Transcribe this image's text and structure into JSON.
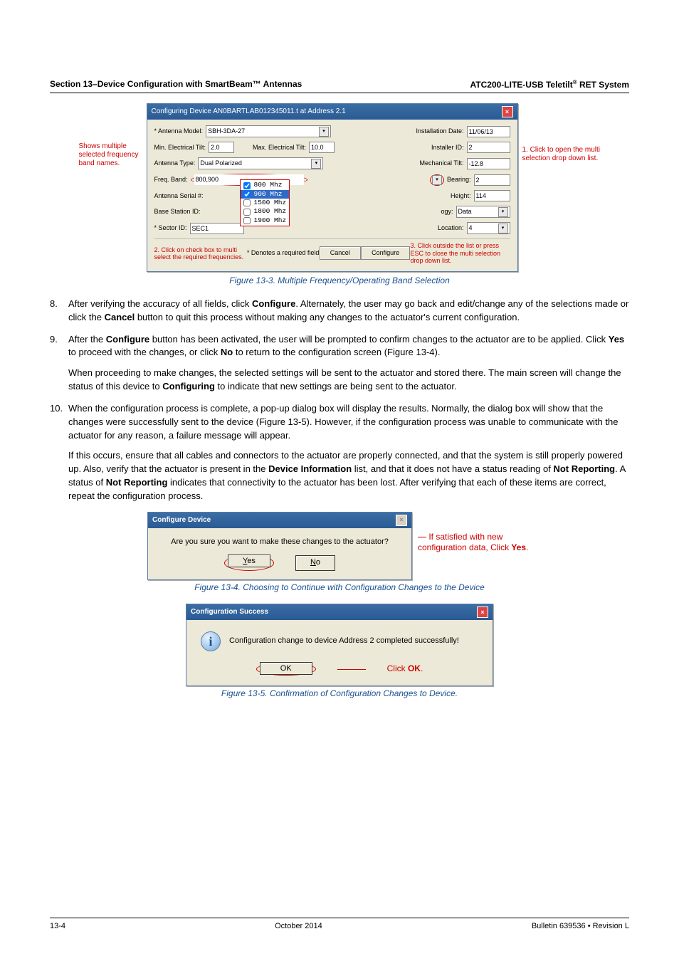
{
  "header": {
    "left": "Section 13–Device Configuration with SmartBeam™ Antennas",
    "right_html": "ATC200-LITE-USB Teletilt<sup>®</sup> RET System"
  },
  "fig1": {
    "titlebar": "Configuring Device AN0BARTLAB012345011.t at Address 2.1",
    "fields": {
      "model_lbl": "* Antenna Model:",
      "model_val": "SBH-3DA-27",
      "inst_date_lbl": "Installation Date:",
      "inst_date_val": "11/06/13",
      "min_tilt_lbl": "Min. Electrical Tilt:",
      "min_tilt_val": "2.0",
      "max_tilt_lbl": "Max. Electrical Tilt:",
      "max_tilt_val": "10.0",
      "installer_lbl": "Installer ID:",
      "installer_val": "2",
      "ant_type_lbl": "Antenna Type:",
      "ant_type_val": "Dual Polarized",
      "mech_tilt_lbl": "Mechanical Tilt:",
      "mech_tilt_val": "-12.8",
      "freq_lbl": "Freq. Band:",
      "freq_val": "800,900",
      "bearing_lbl": "Bearing:",
      "bearing_val": "2",
      "serial_lbl": "Antenna Serial #:",
      "height_lbl": "Height:",
      "height_val": "114",
      "bsid_lbl": "Base Station ID:",
      "ogy_lbl": "ogy:",
      "ogy_val": "Data",
      "sector_lbl": "* Sector ID:",
      "sector_val": "SEC1",
      "loc_lbl": "Location:",
      "loc_val": "4",
      "denotes": "* Denotes a required field",
      "cancel": "Cancel",
      "configure": "Configure"
    },
    "freq_options": [
      {
        "checked": true,
        "label": "800  Mhz",
        "sel": false
      },
      {
        "checked": true,
        "label": "900  Mhz",
        "sel": true
      },
      {
        "checked": false,
        "label": "1500 Mhz",
        "sel": false
      },
      {
        "checked": false,
        "label": "1800 Mhz",
        "sel": false
      },
      {
        "checked": false,
        "label": "1900 Mhz",
        "sel": false
      }
    ],
    "left_note": "Shows multiple selected frequency band names.",
    "right_note": "1. Click to open the multi selection drop down list.",
    "bottom_left": "2. Click  on check box to multi select the required frequencies.",
    "bottom_right": "3. Click  outside the list or press ESC to close the multi selection drop down list.",
    "caption": "Figure 13-3. Multiple Frequency/Operating Band Selection"
  },
  "list": {
    "p8a": "After verifying the accuracy of all fields, click ",
    "p8b": "Configure",
    "p8c": ". Alternately, the user may go back and edit/change any of the selections made or click the ",
    "p8d": "Cancel",
    "p8e": " button to quit this process without making any changes to the actuator's current configuration.",
    "p9a": "After the ",
    "p9b": "Configure",
    "p9c": " button has been activated, the user will be prompted to confirm changes to the actuator are to be applied. Click ",
    "p9d": "Yes",
    "p9e": " to proceed with the changes, or click ",
    "p9f": "No",
    "p9g": " to return to the configuration screen (Figure 13-4).",
    "p9h": "When proceeding to make changes, the selected settings will be sent to the actuator and stored there. The main screen will change the status of this device to ",
    "p9i": "Configuring",
    "p9j": " to indicate that new settings are being sent to the actuator.",
    "p10a": "When the configuration process is complete, a pop-up dialog box will display the results. Normally, the dialog box will show that the changes were successfully sent to the device (Figure 13-5). However, if the configuration process was unable to communicate with the actuator for any reason, a failure message will appear.",
    "p10b": "If this occurs, ensure that all cables and connectors to the actuator are properly connected, and that the system is still properly powered up. Also, verify that the actuator is present in the ",
    "p10c": "Device Information",
    "p10d": " list, and that it does not have a status reading of ",
    "p10e": "Not Reporting",
    "p10f": ". A status of ",
    "p10g": "Not Reporting",
    "p10h": " indicates that connectivity to the actuator has been lost. After verifying that each of these items are correct, repeat the configuration process."
  },
  "fig2": {
    "title": "Configure Device",
    "msg": "Are you sure you want to make these changes to the actuator?",
    "yes": "Yes",
    "no": "No",
    "side1": "If satisfied with new configuration data, Click ",
    "side2": "Yes",
    "side3": ".",
    "caption": "Figure 13-4. Choosing to Continue with Configuration Changes to the Device"
  },
  "fig3": {
    "title": "Configuration Success",
    "msg": "Configuration change to device Address 2 completed successfully!",
    "ok": "OK",
    "click_ok1": "Click ",
    "click_ok2": "OK",
    "click_ok3": ".",
    "caption": "Figure 13-5. Confirmation of Configuration Changes to Device."
  },
  "footer": {
    "left": "13-4",
    "center": "October 2014",
    "right": "Bulletin 639536  •  Revision L"
  }
}
